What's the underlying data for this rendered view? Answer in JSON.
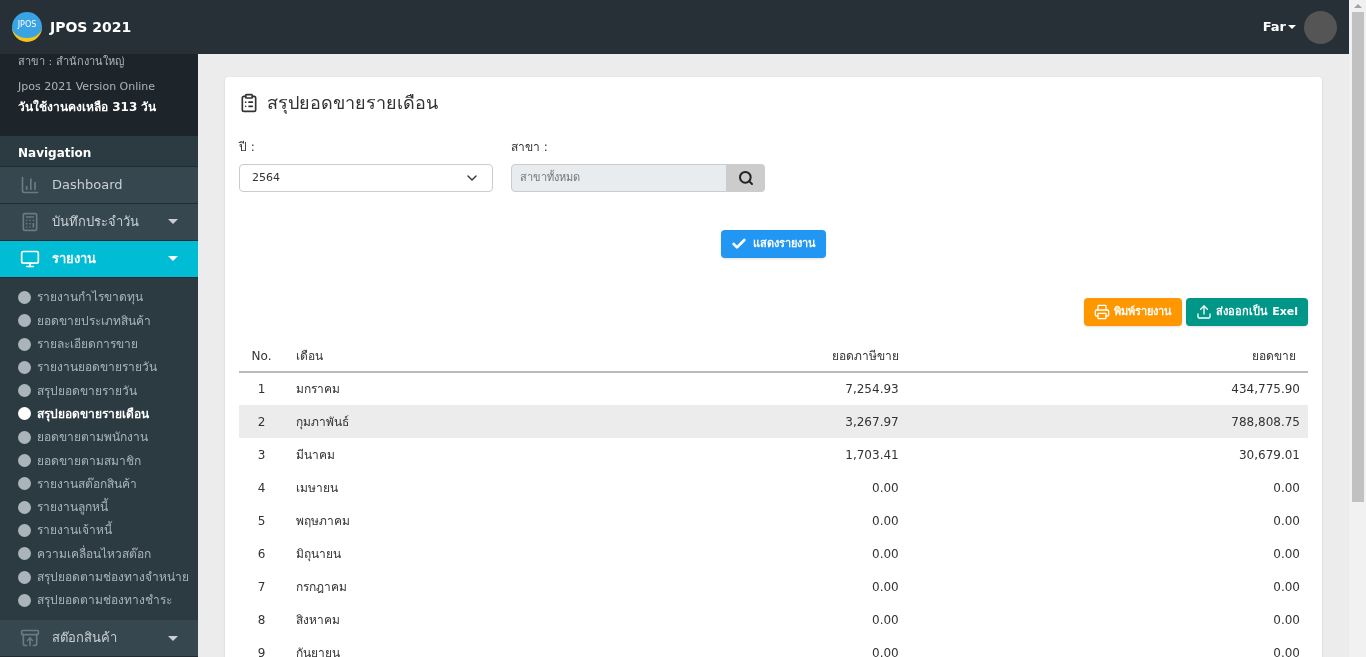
{
  "header": {
    "app_name": "JPOS 2021",
    "logo_text": "JPOS",
    "user": "Far"
  },
  "sidebar": {
    "branch": "สาขา : สำนักงานใหญ่",
    "version": "Jpos 2021 Version Online",
    "days_left": "วันใช้งานคงเหลือ 313 วัน",
    "section_title": "Navigation",
    "items": [
      {
        "kind": "chart",
        "label": "Dashboard",
        "selected": false
      },
      {
        "kind": "register",
        "label": "บันทึกประจำวัน",
        "selected": false,
        "expanded": false
      },
      {
        "kind": "monitor",
        "label": "รายงาน",
        "selected": true,
        "expanded": true,
        "children": [
          {
            "label": "รายงานกำไรขาดทุน",
            "selected": false
          },
          {
            "label": "ยอดขายประเภทสินค้า",
            "selected": false
          },
          {
            "label": "รายละเอียดการขาย",
            "selected": false
          },
          {
            "label": "รายงานยอดขายรายวัน",
            "selected": false
          },
          {
            "label": "สรุปยอดขายรายวัน",
            "selected": false
          },
          {
            "label": "สรุปยอดขายรายเดือน",
            "selected": true
          },
          {
            "label": "ยอดขายตามพนักงาน",
            "selected": false
          },
          {
            "label": "ยอดขายตามสมาชิก",
            "selected": false
          },
          {
            "label": "รายงานสต๊อกสินค้า",
            "selected": false
          },
          {
            "label": "รายงานลูกหนี้",
            "selected": false
          },
          {
            "label": "รายงานเจ้าหนี้",
            "selected": false
          },
          {
            "label": "ความเคลื่อนไหวสต๊อก",
            "selected": false
          },
          {
            "label": "สรุปยอดตามช่องทางจำหน่าย",
            "selected": false
          },
          {
            "label": "สรุปยอดตามช่องทางชำระ",
            "selected": false
          }
        ]
      },
      {
        "kind": "box",
        "label": "สต๊อกสินค้า",
        "selected": false,
        "expanded": false
      }
    ]
  },
  "page": {
    "title": "สรุปยอดขายรายเดือน",
    "year": {
      "label": "ปี :",
      "value": "2564"
    },
    "branch": {
      "label": "สาขา :",
      "placeholder": "สาขาทั้งหมด"
    },
    "show_button": "แสดงรายงาน",
    "print_button": "พิมพ์รายงาน",
    "export_button": "ส่งออกเป็น Exel",
    "table": {
      "columns": [
        "No.",
        "เดือน",
        "ยอดภาษีขาย",
        "ยอดขาย"
      ],
      "rows": [
        {
          "no": "1",
          "month": "มกราคม",
          "tax": "7,254.93",
          "sales": "434,775.90",
          "selected": false
        },
        {
          "no": "2",
          "month": "กุมภาพันธ์",
          "tax": "3,267.97",
          "sales": "788,808.75",
          "selected": true
        },
        {
          "no": "3",
          "month": "มีนาคม",
          "tax": "1,703.41",
          "sales": "30,679.01",
          "selected": false
        },
        {
          "no": "4",
          "month": "เมษายน",
          "tax": "0.00",
          "sales": "0.00",
          "selected": false
        },
        {
          "no": "5",
          "month": "พฤษภาคม",
          "tax": "0.00",
          "sales": "0.00",
          "selected": false
        },
        {
          "no": "6",
          "month": "มิถุนายน",
          "tax": "0.00",
          "sales": "0.00",
          "selected": false
        },
        {
          "no": "7",
          "month": "กรกฎาคม",
          "tax": "0.00",
          "sales": "0.00",
          "selected": false
        },
        {
          "no": "8",
          "month": "สิงหาคม",
          "tax": "0.00",
          "sales": "0.00",
          "selected": false
        },
        {
          "no": "9",
          "month": "กันยายน",
          "tax": "0.00",
          "sales": "0.00",
          "selected": false
        }
      ]
    }
  }
}
